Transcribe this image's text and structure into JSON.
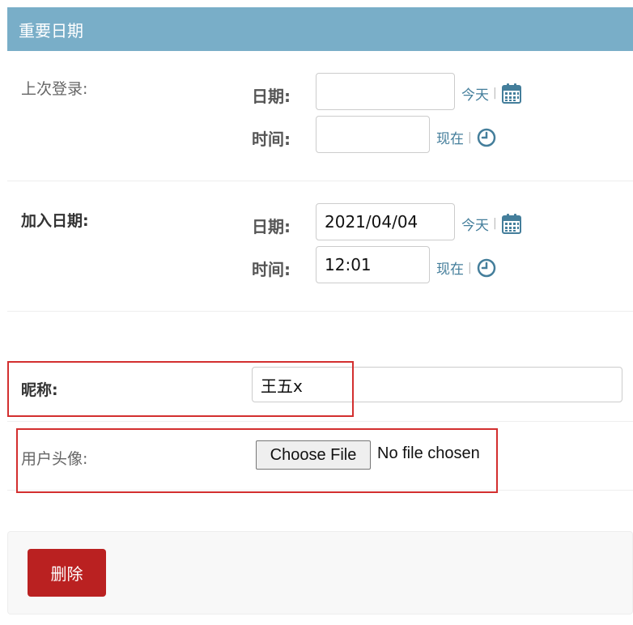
{
  "module": {
    "title": "重要日期"
  },
  "last_login": {
    "label": "上次登录:",
    "date_label": "日期:",
    "date_value": "",
    "today_link": "今天",
    "separator": "|",
    "time_label": "时间:",
    "time_value": "",
    "now_link": "现在"
  },
  "date_joined": {
    "label": "加入日期:",
    "date_label": "日期:",
    "date_value": "2021/04/04",
    "today_link": "今天",
    "separator": "|",
    "time_label": "时间:",
    "time_value": "12:01",
    "now_link": "现在"
  },
  "nickname": {
    "label": "昵称:",
    "value": "王五x"
  },
  "avatar": {
    "label": "用户头像:",
    "button_label": "Choose File",
    "status": "No file chosen"
  },
  "actions": {
    "delete_label": "删除"
  },
  "colors": {
    "header_bg": "#79aec8",
    "link": "#447e9b",
    "delete_bg": "#ba2121",
    "highlight": "#d32f2f"
  },
  "icons": {
    "calendar": "calendar-icon",
    "clock": "clock-icon"
  }
}
